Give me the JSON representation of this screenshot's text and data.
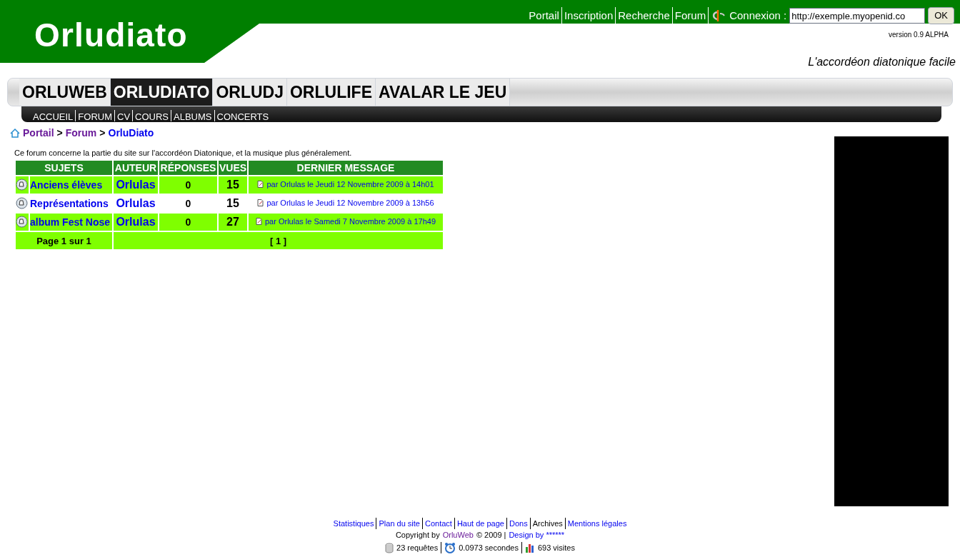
{
  "header": {
    "logo": "Orludiato",
    "top_links": [
      "Portail",
      "Inscription",
      "Recherche",
      "Forum"
    ],
    "login_label": "Connexion :",
    "login_value": "http://exemple.myopenid.co",
    "ok_button": "OK",
    "version": "version 0.9 ALPHA",
    "tagline": "L'accordéon diatonique facile"
  },
  "main_tabs": [
    {
      "label": "ORLUWEB",
      "selected": false
    },
    {
      "label": "ORLUDIATO",
      "selected": true
    },
    {
      "label": "ORLUDJ",
      "selected": false
    },
    {
      "label": "ORLULIFE",
      "selected": false
    },
    {
      "label": "AVALAR LE JEU",
      "selected": false
    }
  ],
  "sub_tabs": [
    "ACCUEIL",
    "FORUM",
    "CV",
    "COURS",
    "ALBUMS",
    "CONCERTS"
  ],
  "breadcrumb": [
    {
      "label": "Portail",
      "current": false,
      "separator": ">"
    },
    {
      "label": "Forum",
      "current": false,
      "separator": ">"
    },
    {
      "label": "OrluDiato",
      "current": true
    }
  ],
  "description": "Ce forum concerne la partie du site sur l'accordéon Diatonique, et la musique plus généralement.",
  "table": {
    "columns": [
      "SUJETS",
      "AUTEUR",
      "RÉPONSES",
      "VUES",
      "DERNIER MESSAGE"
    ],
    "rows": [
      {
        "subject": "Anciens élèves",
        "author": "Orlulas",
        "replies": "0",
        "views": "15",
        "last": "par Orlulas le Jeudi 12 Novembre 2009 à 14h01",
        "highlighted": true
      },
      {
        "subject": "Représentations",
        "author": "Orlulas",
        "replies": "0",
        "views": "15",
        "last": "par Orlulas le Jeudi 12 Novembre 2009 à 13h56",
        "highlighted": false
      },
      {
        "subject": "album Fest Nose",
        "author": "Orlulas",
        "replies": "0",
        "views": "27",
        "last": "par Orlulas le Samedi 7 Novembre 2009 à 17h49",
        "highlighted": true
      }
    ],
    "page_info": "Page 1 sur 1",
    "pages": "[ 1 ]"
  },
  "footer": {
    "links": [
      {
        "label": "Statistiques",
        "link": true
      },
      {
        "label": "Plan du site",
        "link": true
      },
      {
        "label": "Contact",
        "link": true
      },
      {
        "label": "Haut de page",
        "link": true
      },
      {
        "label": "Dons",
        "link": true
      },
      {
        "label": "Archives",
        "link": false
      },
      {
        "label": "Mentions légales",
        "link": true
      }
    ],
    "copyright_prefix": "Copyright by",
    "copyright_link": "OrluWeb",
    "copyright_suffix": "© 2009 |",
    "design_link": "Design by ******",
    "stats": [
      "23 requêtes",
      "0.0973 secondes",
      "693 visites"
    ]
  }
}
